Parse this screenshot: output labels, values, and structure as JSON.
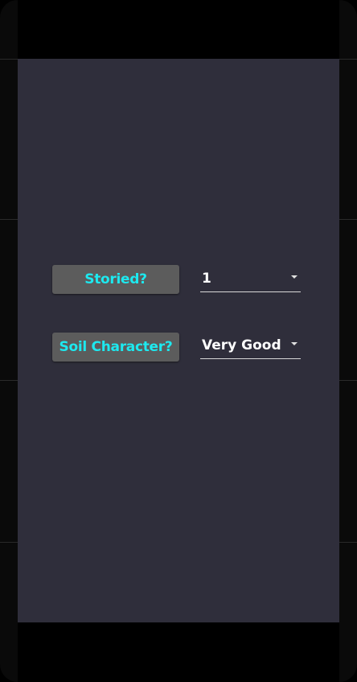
{
  "form": {
    "storied": {
      "label": "Storied?",
      "selected": "1"
    },
    "soil_character": {
      "label": "Soil Character?",
      "selected": "Very Good"
    }
  },
  "icons": {
    "dropdown_arrow": "caret-down-icon"
  },
  "colors": {
    "screen_background": "#2f2e3b",
    "label_background": "#5c5c5c",
    "label_text": "#1de9ef",
    "value_text": "#ffffff"
  }
}
